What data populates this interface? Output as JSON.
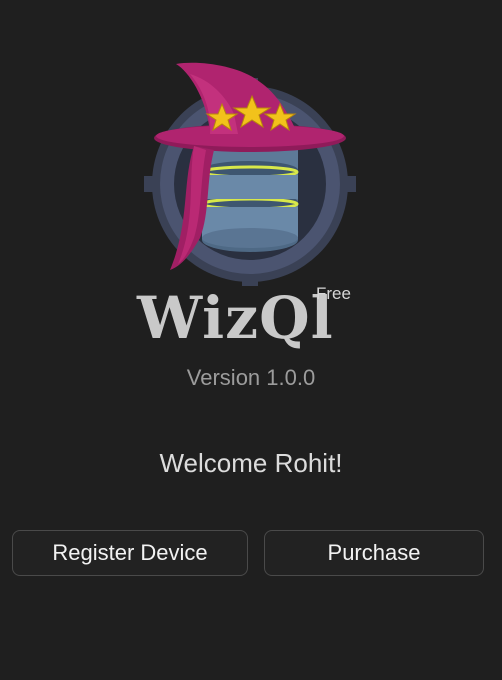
{
  "app": {
    "logo_icon": "wizard-hat-database-logo",
    "name": "WizQl",
    "edition_badge": "Free",
    "version": "Version 1.0.0"
  },
  "welcome": {
    "message": "Welcome Rohit!"
  },
  "actions": {
    "register_label": "Register Device",
    "purchase_label": "Purchase"
  },
  "colors": {
    "background": "#1f1f1f",
    "hat_magenta": "#b0246f",
    "stars_gold": "#f2c21b",
    "database_blue": "#5d7a98",
    "database_stripe": "#d8e84a"
  }
}
